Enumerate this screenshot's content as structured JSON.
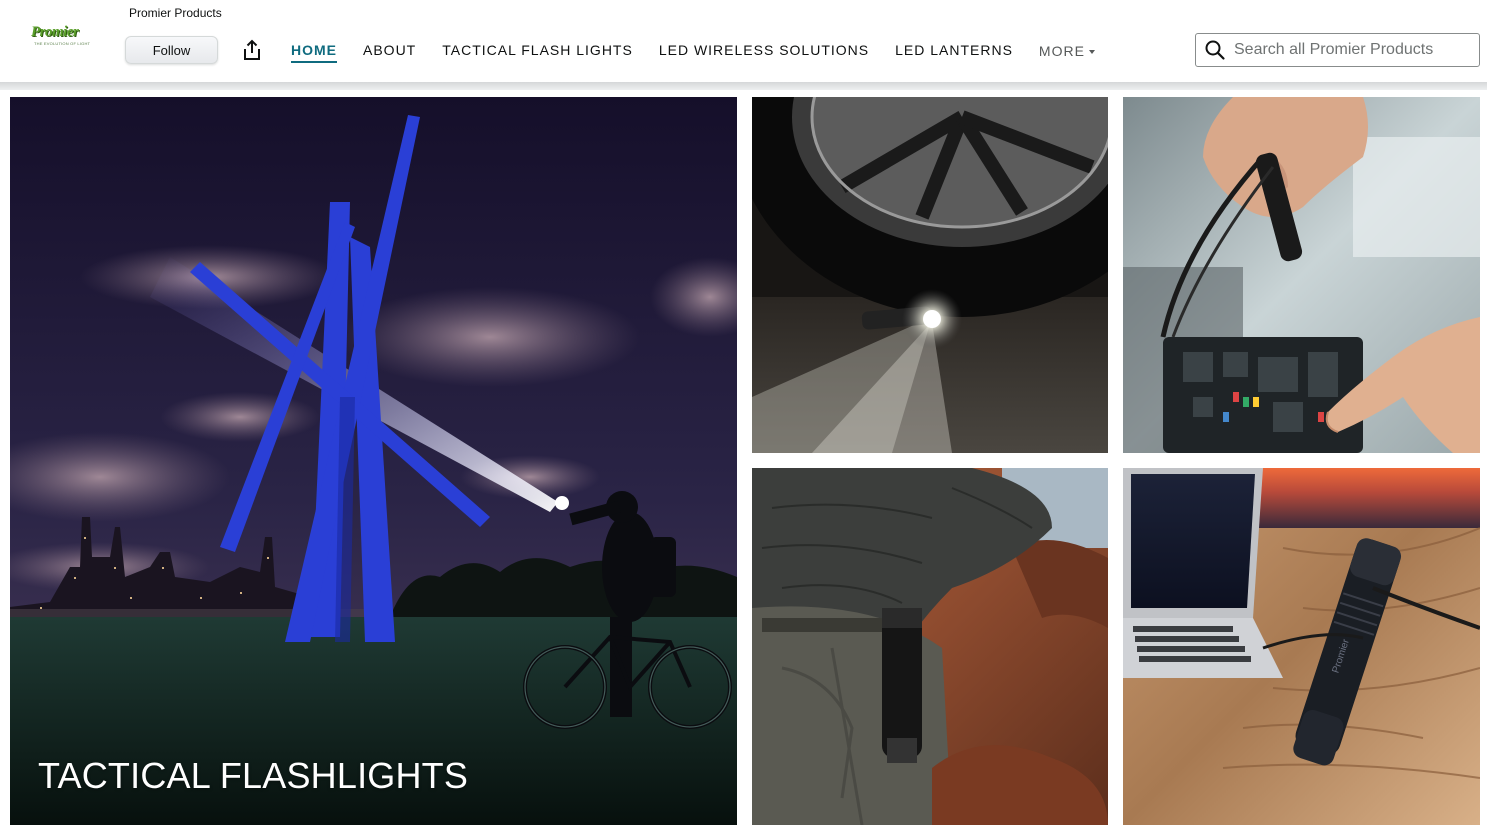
{
  "store": {
    "logo_text": "Promier",
    "logo_tagline": "THE EVOLUTION OF LIGHT",
    "brand_name": "Promier Products",
    "follow_label": "Follow"
  },
  "nav": {
    "items": [
      {
        "label": "HOME",
        "active": true
      },
      {
        "label": "ABOUT",
        "active": false
      },
      {
        "label": "TACTICAL FLASH LIGHTS",
        "active": false
      },
      {
        "label": "LED WIRELESS SOLUTIONS",
        "active": false
      },
      {
        "label": "LED LANTERNS",
        "active": false
      },
      {
        "label": "MORE",
        "active": false
      }
    ]
  },
  "search": {
    "placeholder": "Search all Promier Products",
    "value": ""
  },
  "icons": {
    "share": "share-icon",
    "search": "search-icon",
    "more_caret": "caret-down-icon"
  },
  "colors": {
    "active_nav": "#0f6b7f",
    "logo_green": "#5a9f2a"
  },
  "tiles": {
    "hero": {
      "label": "TACTICAL FLASHLIGHTS",
      "image": "cyclist shining flashlight at blue sculpture at night"
    },
    "tile2": {
      "image": "flashlight lying under car wheel"
    },
    "tile3": {
      "image": "hand holding flashlight over car fuse box"
    },
    "tile4": {
      "image": "flashlight clipped on jeans pocket while climbing rock"
    },
    "tile5": {
      "image": "flashlight charging next to laptop on wood stump"
    }
  }
}
